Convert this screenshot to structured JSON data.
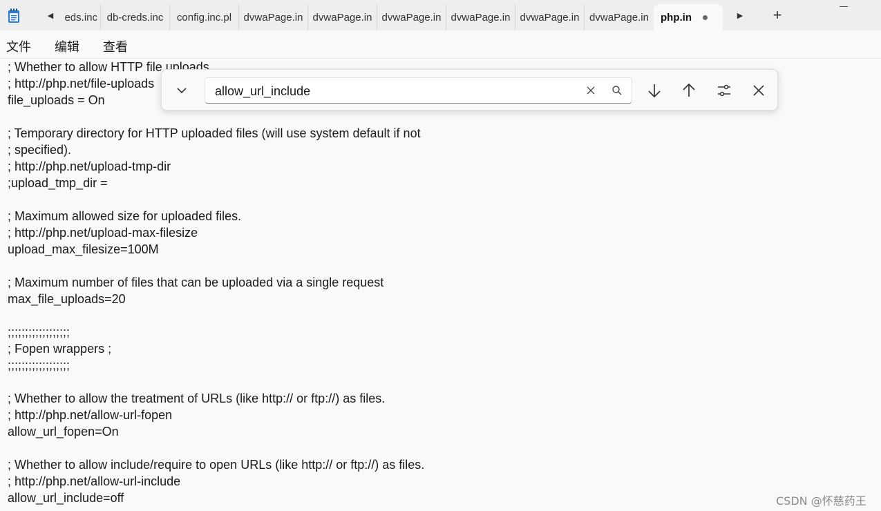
{
  "tabs": [
    {
      "label": "eds.inc"
    },
    {
      "label": "db-creds.inc"
    },
    {
      "label": "config.inc.pl"
    },
    {
      "label": "dvwaPage.in"
    },
    {
      "label": "dvwaPage.in"
    },
    {
      "label": "dvwaPage.in"
    },
    {
      "label": "dvwaPage.in"
    },
    {
      "label": "dvwaPage.in"
    },
    {
      "label": "php.in",
      "active": true
    }
  ],
  "menu": {
    "file": "文件",
    "edit": "编辑",
    "view": "查看"
  },
  "find": {
    "query": "allow_url_include"
  },
  "editor_lines": [
    "; Whether to allow HTTP file uploads.",
    "; http://php.net/file-uploads",
    "file_uploads = On",
    "",
    "; Temporary directory for HTTP uploaded files (will use system default if not",
    "; specified).",
    "; http://php.net/upload-tmp-dir",
    ";upload_tmp_dir =",
    "",
    "; Maximum allowed size for uploaded files.",
    "; http://php.net/upload-max-filesize",
    "upload_max_filesize=100M",
    "",
    "; Maximum number of files that can be uploaded via a single request",
    "max_file_uploads=20",
    "",
    ";;;;;;;;;;;;;;;;;;",
    "; Fopen wrappers ;",
    ";;;;;;;;;;;;;;;;;;",
    "",
    "; Whether to allow the treatment of URLs (like http:// or ftp://) as files.",
    "; http://php.net/allow-url-fopen",
    "allow_url_fopen=On",
    "",
    "; Whether to allow include/require to open URLs (like http:// or ftp://) as files.",
    "; http://php.net/allow-url-include",
    "allow_url_include=off"
  ],
  "watermark": "CSDN @怀慈药王"
}
